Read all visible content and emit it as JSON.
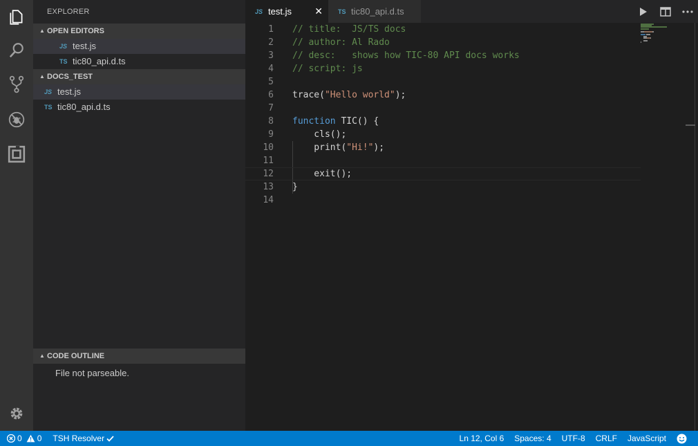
{
  "sidebar": {
    "title": "EXPLORER",
    "open_editors": {
      "label": "OPEN EDITORS",
      "files": [
        {
          "icon": "JS",
          "name": "test.js"
        },
        {
          "icon": "TS",
          "name": "tic80_api.d.ts"
        }
      ]
    },
    "folder": {
      "label": "DOCS_TEST",
      "files": [
        {
          "icon": "JS",
          "name": "test.js"
        },
        {
          "icon": "TS",
          "name": "tic80_api.d.ts"
        }
      ]
    },
    "outline": {
      "label": "CODE OUTLINE",
      "message": "File not parseable."
    }
  },
  "tabs": [
    {
      "icon": "JS",
      "name": "test.js",
      "close": "✕"
    },
    {
      "icon": "TS",
      "name": "tic80_api.d.ts"
    }
  ],
  "editor": {
    "line_numbers": [
      "1",
      "2",
      "3",
      "4",
      "5",
      "6",
      "7",
      "8",
      "9",
      "10",
      "11",
      "12",
      "13",
      "14"
    ],
    "lines": [
      [
        {
          "c": "c-com",
          "t": "// title:  JS/TS docs"
        }
      ],
      [
        {
          "c": "c-com",
          "t": "// author: Al Rado"
        }
      ],
      [
        {
          "c": "c-com",
          "t": "// desc:   shows how TIC-80 API docs works"
        }
      ],
      [
        {
          "c": "c-com",
          "t": "// script: js"
        }
      ],
      [],
      [
        {
          "c": "c-fn",
          "t": "trace("
        },
        {
          "c": "c-str",
          "t": "\"Hello world\""
        },
        {
          "c": "c-pl",
          "t": ");"
        }
      ],
      [],
      [
        {
          "c": "c-kw",
          "t": "function"
        },
        {
          "c": "c-pl",
          "t": " TIC() {"
        }
      ],
      [
        {
          "c": "c-pl",
          "t": "    cls();"
        }
      ],
      [
        {
          "c": "c-pl",
          "t": "    print("
        },
        {
          "c": "c-str",
          "t": "\"Hi!\""
        },
        {
          "c": "c-pl",
          "t": ");"
        }
      ],
      [],
      [
        {
          "c": "c-pl",
          "t": "    exit();"
        }
      ],
      [
        {
          "c": "c-pl",
          "t": "}"
        }
      ],
      []
    ]
  },
  "status": {
    "errors": "0",
    "warnings": "0",
    "resolver": "TSH Resolver",
    "position": "Ln 12, Col 6",
    "spaces": "Spaces: 4",
    "encoding": "UTF-8",
    "eol": "CRLF",
    "language": "JavaScript"
  },
  "colors": {
    "accent": "#007acc",
    "activity_bar": "#333333",
    "sidebar": "#252526",
    "editor": "#1e1e1e"
  }
}
